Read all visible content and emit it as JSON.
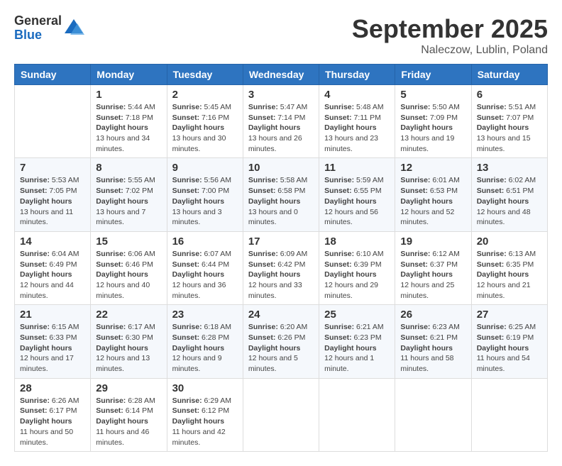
{
  "logo": {
    "general": "General",
    "blue": "Blue"
  },
  "title": {
    "month": "September 2025",
    "location": "Naleczow, Lublin, Poland"
  },
  "weekdays": [
    "Sunday",
    "Monday",
    "Tuesday",
    "Wednesday",
    "Thursday",
    "Friday",
    "Saturday"
  ],
  "weeks": [
    [
      {
        "day": "",
        "sunrise": "",
        "sunset": "",
        "daylight": ""
      },
      {
        "day": "1",
        "sunrise": "5:44 AM",
        "sunset": "7:18 PM",
        "daylight": "13 hours and 34 minutes."
      },
      {
        "day": "2",
        "sunrise": "5:45 AM",
        "sunset": "7:16 PM",
        "daylight": "13 hours and 30 minutes."
      },
      {
        "day": "3",
        "sunrise": "5:47 AM",
        "sunset": "7:14 PM",
        "daylight": "13 hours and 26 minutes."
      },
      {
        "day": "4",
        "sunrise": "5:48 AM",
        "sunset": "7:11 PM",
        "daylight": "13 hours and 23 minutes."
      },
      {
        "day": "5",
        "sunrise": "5:50 AM",
        "sunset": "7:09 PM",
        "daylight": "13 hours and 19 minutes."
      },
      {
        "day": "6",
        "sunrise": "5:51 AM",
        "sunset": "7:07 PM",
        "daylight": "13 hours and 15 minutes."
      }
    ],
    [
      {
        "day": "7",
        "sunrise": "5:53 AM",
        "sunset": "7:05 PM",
        "daylight": "13 hours and 11 minutes."
      },
      {
        "day": "8",
        "sunrise": "5:55 AM",
        "sunset": "7:02 PM",
        "daylight": "13 hours and 7 minutes."
      },
      {
        "day": "9",
        "sunrise": "5:56 AM",
        "sunset": "7:00 PM",
        "daylight": "13 hours and 3 minutes."
      },
      {
        "day": "10",
        "sunrise": "5:58 AM",
        "sunset": "6:58 PM",
        "daylight": "13 hours and 0 minutes."
      },
      {
        "day": "11",
        "sunrise": "5:59 AM",
        "sunset": "6:55 PM",
        "daylight": "12 hours and 56 minutes."
      },
      {
        "day": "12",
        "sunrise": "6:01 AM",
        "sunset": "6:53 PM",
        "daylight": "12 hours and 52 minutes."
      },
      {
        "day": "13",
        "sunrise": "6:02 AM",
        "sunset": "6:51 PM",
        "daylight": "12 hours and 48 minutes."
      }
    ],
    [
      {
        "day": "14",
        "sunrise": "6:04 AM",
        "sunset": "6:49 PM",
        "daylight": "12 hours and 44 minutes."
      },
      {
        "day": "15",
        "sunrise": "6:06 AM",
        "sunset": "6:46 PM",
        "daylight": "12 hours and 40 minutes."
      },
      {
        "day": "16",
        "sunrise": "6:07 AM",
        "sunset": "6:44 PM",
        "daylight": "12 hours and 36 minutes."
      },
      {
        "day": "17",
        "sunrise": "6:09 AM",
        "sunset": "6:42 PM",
        "daylight": "12 hours and 33 minutes."
      },
      {
        "day": "18",
        "sunrise": "6:10 AM",
        "sunset": "6:39 PM",
        "daylight": "12 hours and 29 minutes."
      },
      {
        "day": "19",
        "sunrise": "6:12 AM",
        "sunset": "6:37 PM",
        "daylight": "12 hours and 25 minutes."
      },
      {
        "day": "20",
        "sunrise": "6:13 AM",
        "sunset": "6:35 PM",
        "daylight": "12 hours and 21 minutes."
      }
    ],
    [
      {
        "day": "21",
        "sunrise": "6:15 AM",
        "sunset": "6:33 PM",
        "daylight": "12 hours and 17 minutes."
      },
      {
        "day": "22",
        "sunrise": "6:17 AM",
        "sunset": "6:30 PM",
        "daylight": "12 hours and 13 minutes."
      },
      {
        "day": "23",
        "sunrise": "6:18 AM",
        "sunset": "6:28 PM",
        "daylight": "12 hours and 9 minutes."
      },
      {
        "day": "24",
        "sunrise": "6:20 AM",
        "sunset": "6:26 PM",
        "daylight": "12 hours and 5 minutes."
      },
      {
        "day": "25",
        "sunrise": "6:21 AM",
        "sunset": "6:23 PM",
        "daylight": "12 hours and 1 minute."
      },
      {
        "day": "26",
        "sunrise": "6:23 AM",
        "sunset": "6:21 PM",
        "daylight": "11 hours and 58 minutes."
      },
      {
        "day": "27",
        "sunrise": "6:25 AM",
        "sunset": "6:19 PM",
        "daylight": "11 hours and 54 minutes."
      }
    ],
    [
      {
        "day": "28",
        "sunrise": "6:26 AM",
        "sunset": "6:17 PM",
        "daylight": "11 hours and 50 minutes."
      },
      {
        "day": "29",
        "sunrise": "6:28 AM",
        "sunset": "6:14 PM",
        "daylight": "11 hours and 46 minutes."
      },
      {
        "day": "30",
        "sunrise": "6:29 AM",
        "sunset": "6:12 PM",
        "daylight": "11 hours and 42 minutes."
      },
      {
        "day": "",
        "sunrise": "",
        "sunset": "",
        "daylight": ""
      },
      {
        "day": "",
        "sunrise": "",
        "sunset": "",
        "daylight": ""
      },
      {
        "day": "",
        "sunrise": "",
        "sunset": "",
        "daylight": ""
      },
      {
        "day": "",
        "sunrise": "",
        "sunset": "",
        "daylight": ""
      }
    ]
  ]
}
